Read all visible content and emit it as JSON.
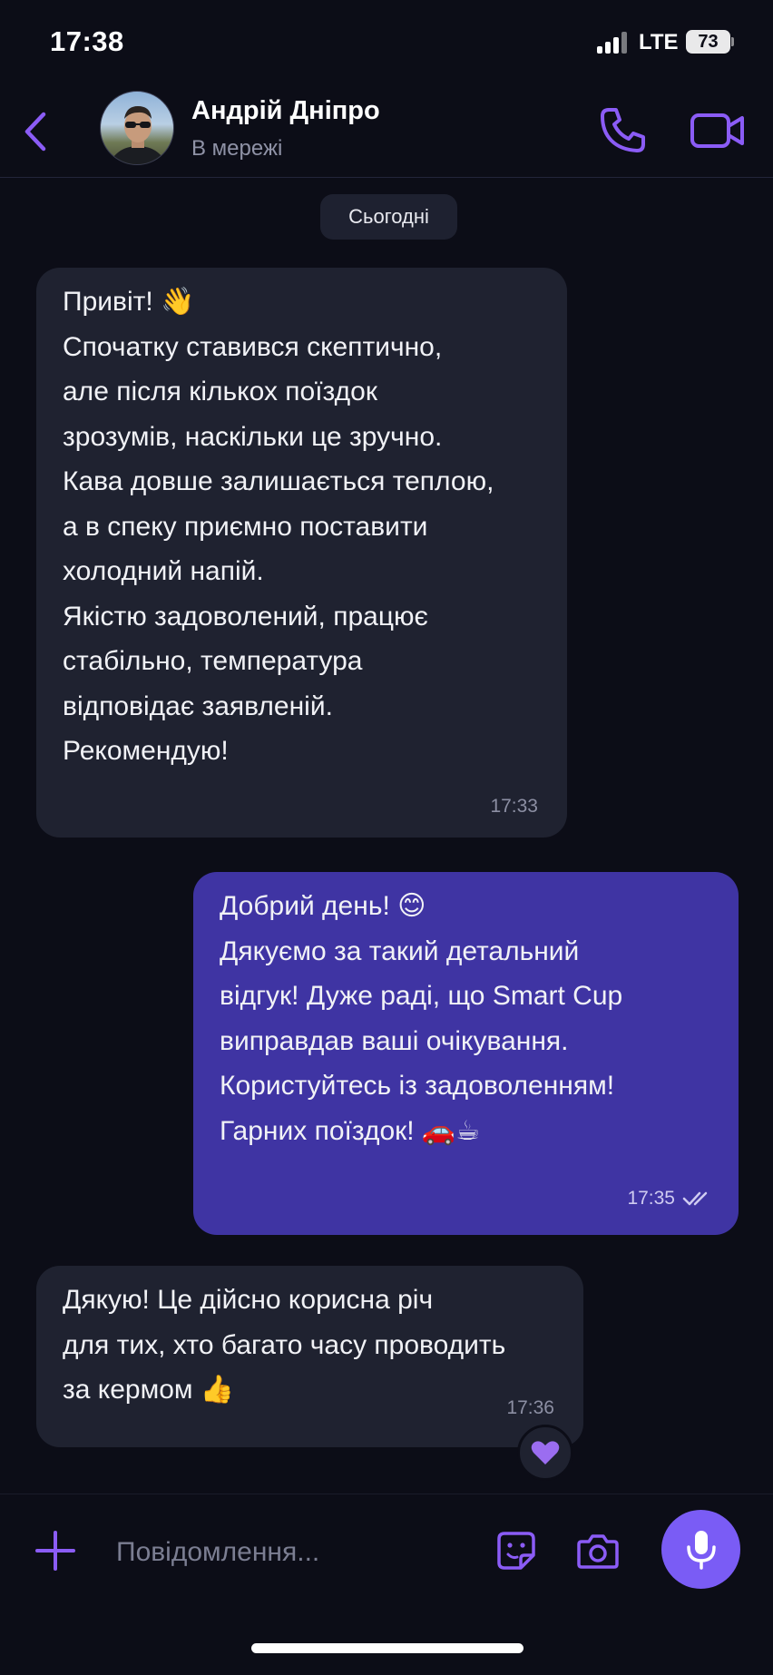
{
  "status_bar": {
    "time": "17:38",
    "network": "LTE",
    "battery": "73"
  },
  "header": {
    "contact_name": "Андрій Дніпро",
    "contact_status": "В мережі"
  },
  "date_separator": "Сьогодні",
  "messages": [
    {
      "direction": "incoming",
      "text": "Привіт! 👋\nСпочатку ставився скептично,\nале після кількох поїздок\nзрозумів, наскільки це зручно.\nКава довше залишається теплою,\nа в спеку приємно поставити\nхолодний напій.\nЯкістю задоволений, працює\nстабільно, температура\nвідповідає заявленій.\nРекомендую!",
      "time": "17:33"
    },
    {
      "direction": "outgoing",
      "text": "Добрий день! 😊\nДякуємо за такий детальний\nвідгук! Дуже раді, що Smart Cup\nвиправдав ваші очікування.\nКористуйтесь із задоволенням!\nГарних поїздок! 🚗☕",
      "time": "17:35",
      "read_receipt": "double-check-icon"
    },
    {
      "direction": "incoming",
      "text": "Дякую! Це дійсно корисна річ\nдля тих, хто багато часу проводить\nза кермом 👍",
      "time": "17:36",
      "reaction": "💜"
    }
  ],
  "composer": {
    "placeholder": "Повідомлення..."
  },
  "colors": {
    "background": "#0c0d17",
    "accent": "#8b5cf6",
    "incoming_bubble": "#1f2230",
    "outgoing_bubble": "#3f34a3",
    "mic_button": "#7a5cf5"
  }
}
